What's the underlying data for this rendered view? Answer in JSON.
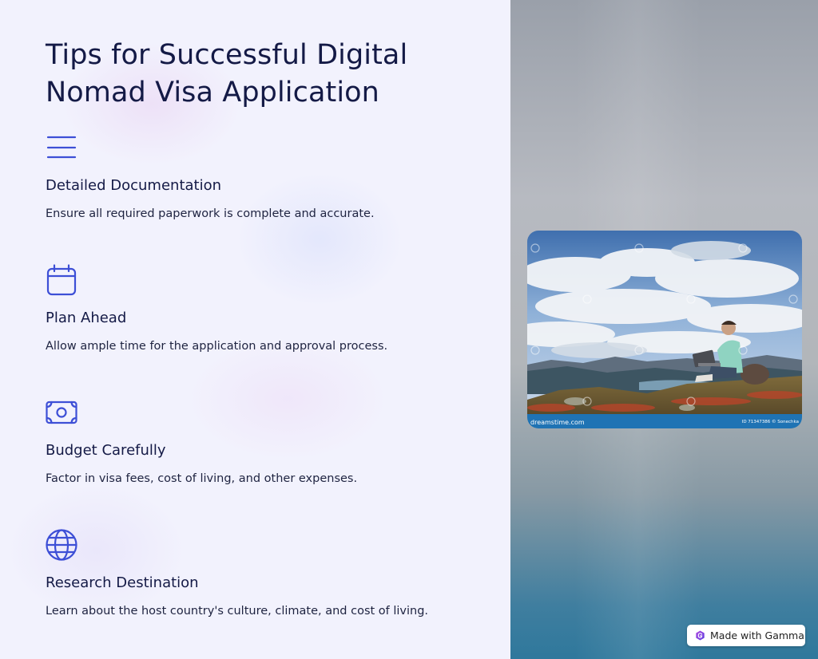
{
  "page": {
    "title": "Tips for Successful Digital Nomad Visa Application"
  },
  "tips": [
    {
      "icon": "menu-icon",
      "title": "Detailed Documentation",
      "description": "Ensure all required paperwork is complete and accurate."
    },
    {
      "icon": "calendar-icon",
      "title": "Plan Ahead",
      "description": "Allow ample time for the application and approval process."
    },
    {
      "icon": "money-bill-icon",
      "title": "Budget Carefully",
      "description": "Factor in visa fees, cost of living, and other expenses."
    },
    {
      "icon": "globe-icon",
      "title": "Research Destination",
      "description": "Learn about the host country's culture, climate, and cost of living."
    }
  ],
  "photo": {
    "watermark_left": "dreamstime.com",
    "watermark_right": "ID 71347386 © Sonechka"
  },
  "badge": {
    "label": "Made with Gamma"
  },
  "colors": {
    "accent": "#3d4fd6",
    "title_text": "#141a46",
    "body_text": "#1e2340",
    "left_background": "#f2f2fd",
    "watermark_bar": "#1f73b4"
  }
}
